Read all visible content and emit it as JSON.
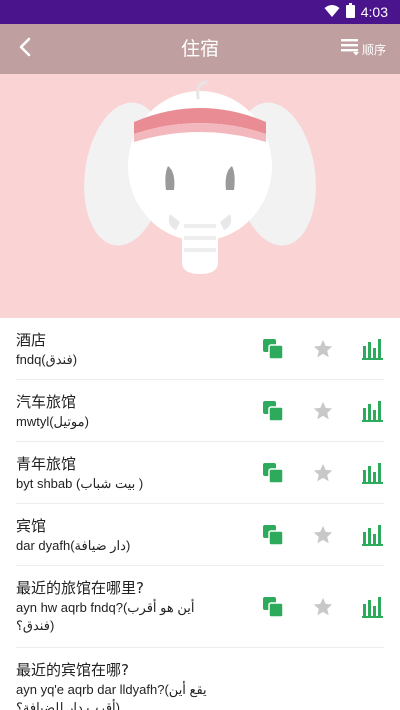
{
  "status_bar": {
    "time": "4:03"
  },
  "app_bar": {
    "title": "住宿",
    "order_label": "顺序"
  },
  "phrases": [
    {
      "chinese": "酒店",
      "translit": "fndq(فندق)"
    },
    {
      "chinese": "汽车旅馆",
      "translit": "mwtyl(موتيل)"
    },
    {
      "chinese": "青年旅馆",
      "translit": "byt shbab (بيت شباب )"
    },
    {
      "chinese": "宾馆",
      "translit": "dar dyafh(دار ضيافة)"
    },
    {
      "chinese": "最近的旅馆在哪里?",
      "translit": "ayn hw aqrb fndq?(أين هو أقرب\nفندق؟)"
    },
    {
      "chinese": "最近的宾馆在哪?",
      "translit": "ayn yq'e aqrb dar lldyafh?(يقع أين\nأقرب دار للضيافة؟)"
    }
  ],
  "colors": {
    "accent_green": "#2eaa5c",
    "star_grey": "#c8c8c8",
    "app_bar": "#bf9f9f",
    "hero_bg": "#fad4d4",
    "status_bar": "#4a148c"
  }
}
